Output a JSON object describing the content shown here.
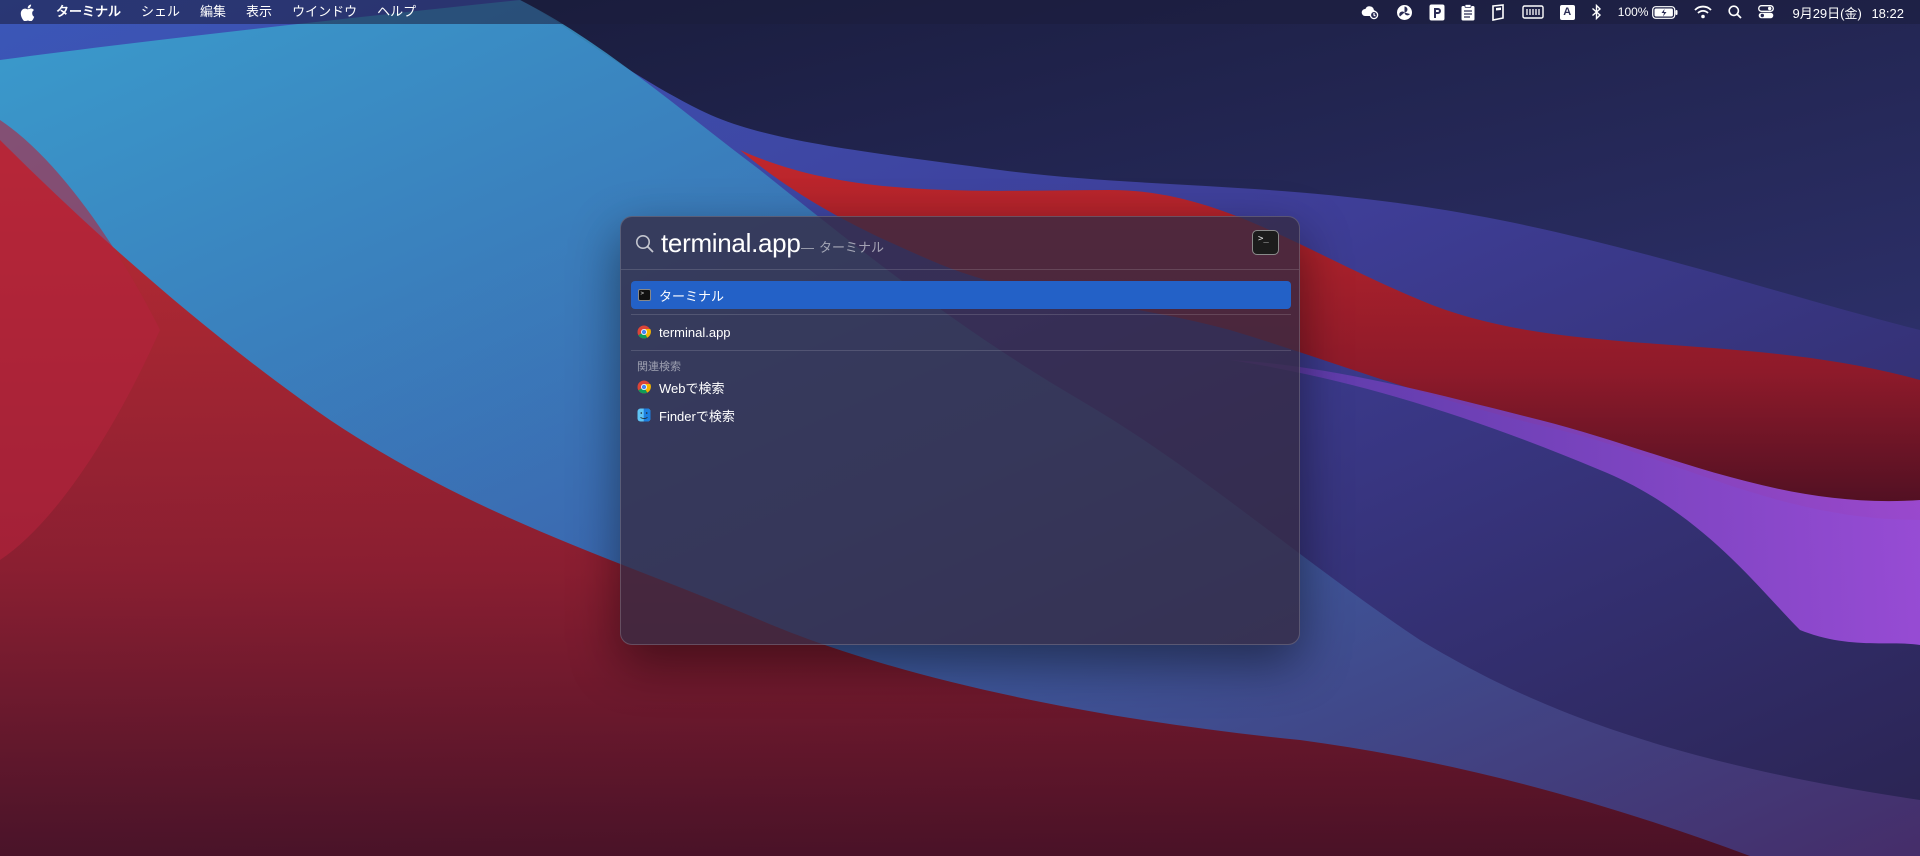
{
  "colors": {
    "accent": "#2361c7",
    "menubar_text": "#ffffff",
    "hint_text": "#a9a3b3"
  },
  "menubar": {
    "app_name": "ターミナル",
    "menus": [
      "シェル",
      "編集",
      "表示",
      "ウインドウ",
      "ヘルプ"
    ],
    "battery_percent": "100%",
    "clock_date": "9月29日(金)",
    "clock_time": "18:22",
    "input_source": "A",
    "tray_icons": [
      "cloud-activity-icon",
      "pinwheel-icon",
      "p-app-icon",
      "clipboard-icon",
      "book-icon",
      "memory-icon",
      "input-source-icon",
      "bluetooth-icon",
      "battery-icon",
      "wifi-icon",
      "spotlight-icon",
      "control-center-icon"
    ]
  },
  "spotlight": {
    "query": "terminal.app",
    "hint_dash": "—",
    "hint": "ターミナル",
    "preview_icon": "terminal-icon",
    "preview_prompt": ">_",
    "top_hit": {
      "label": "ターミナル",
      "icon": "terminal-icon"
    },
    "web_suggestion": {
      "label": "terminal.app",
      "icon": "chrome-icon"
    },
    "related_section_label": "関連検索",
    "related": [
      {
        "label": "Webで検索",
        "icon": "chrome-icon"
      },
      {
        "label": "Finderで検索",
        "icon": "finder-icon"
      }
    ]
  }
}
